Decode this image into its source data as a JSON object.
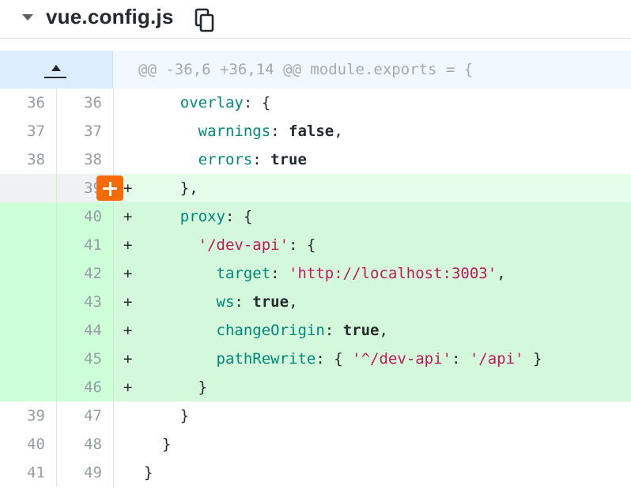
{
  "file": {
    "name": "vue.config.js"
  },
  "hunk": {
    "header": "@@ -36,6 +36,14 @@ module.exports = {"
  },
  "lines": [
    {
      "old": "36",
      "new": "36",
      "marker": "",
      "indent": "    ",
      "parts": [
        {
          "t": "overlay",
          "c": "pk"
        },
        {
          "t": ": {",
          "c": ""
        }
      ]
    },
    {
      "old": "37",
      "new": "37",
      "marker": "",
      "indent": "      ",
      "parts": [
        {
          "t": "warnings",
          "c": "pk"
        },
        {
          "t": ": ",
          "c": ""
        },
        {
          "t": "false",
          "c": "kw"
        },
        {
          "t": ",",
          "c": ""
        }
      ]
    },
    {
      "old": "38",
      "new": "38",
      "marker": "",
      "indent": "      ",
      "parts": [
        {
          "t": "errors",
          "c": "pk"
        },
        {
          "t": ": ",
          "c": ""
        },
        {
          "t": "true",
          "c": "kw"
        }
      ]
    },
    {
      "old": "",
      "new": "39",
      "marker": "+",
      "indent": "    ",
      "parts": [
        {
          "t": "},",
          "c": ""
        }
      ]
    },
    {
      "old": "",
      "new": "40",
      "marker": "+",
      "indent": "    ",
      "parts": [
        {
          "t": "proxy",
          "c": "pk"
        },
        {
          "t": ": {",
          "c": ""
        }
      ]
    },
    {
      "old": "",
      "new": "41",
      "marker": "+",
      "indent": "      ",
      "parts": [
        {
          "t": "'/dev-api'",
          "c": "s"
        },
        {
          "t": ": {",
          "c": ""
        }
      ]
    },
    {
      "old": "",
      "new": "42",
      "marker": "+",
      "indent": "        ",
      "parts": [
        {
          "t": "target",
          "c": "pk"
        },
        {
          "t": ": ",
          "c": ""
        },
        {
          "t": "'http://localhost:3003'",
          "c": "s"
        },
        {
          "t": ",",
          "c": ""
        }
      ]
    },
    {
      "old": "",
      "new": "43",
      "marker": "+",
      "indent": "        ",
      "parts": [
        {
          "t": "ws",
          "c": "pk"
        },
        {
          "t": ": ",
          "c": ""
        },
        {
          "t": "true",
          "c": "kw"
        },
        {
          "t": ",",
          "c": ""
        }
      ]
    },
    {
      "old": "",
      "new": "44",
      "marker": "+",
      "indent": "        ",
      "parts": [
        {
          "t": "changeOrigin",
          "c": "pk"
        },
        {
          "t": ": ",
          "c": ""
        },
        {
          "t": "true",
          "c": "kw"
        },
        {
          "t": ",",
          "c": ""
        }
      ]
    },
    {
      "old": "",
      "new": "45",
      "marker": "+",
      "indent": "        ",
      "parts": [
        {
          "t": "pathRewrite",
          "c": "pk"
        },
        {
          "t": ": { ",
          "c": ""
        },
        {
          "t": "'^/dev-api'",
          "c": "s"
        },
        {
          "t": ": ",
          "c": ""
        },
        {
          "t": "'/api'",
          "c": "s"
        },
        {
          "t": " }",
          "c": ""
        }
      ]
    },
    {
      "old": "",
      "new": "46",
      "marker": "+",
      "indent": "      ",
      "parts": [
        {
          "t": "}",
          "c": ""
        }
      ]
    },
    {
      "old": "39",
      "new": "47",
      "marker": "",
      "indent": "    ",
      "parts": [
        {
          "t": "}",
          "c": ""
        }
      ]
    },
    {
      "old": "40",
      "new": "48",
      "marker": "",
      "indent": "  ",
      "parts": [
        {
          "t": "}",
          "c": ""
        }
      ]
    },
    {
      "old": "41",
      "new": "49",
      "marker": "",
      "indent": "",
      "parts": [
        {
          "t": "}",
          "c": ""
        }
      ]
    }
  ],
  "colors": {
    "addition_bg": "#d4f8db",
    "hunk_bg": "#f1f8ff",
    "plus_button": "#f66a0a"
  },
  "icons": {
    "collapse": "chevron-down-icon",
    "copy": "copy-icon",
    "expand": "expand-up-icon",
    "add_comment": "plus-icon"
  }
}
